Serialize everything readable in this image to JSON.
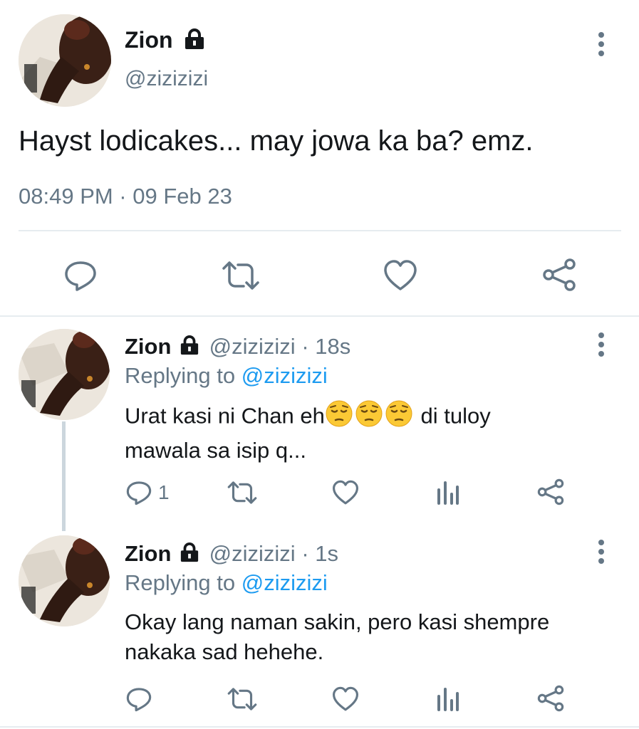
{
  "main_tweet": {
    "name": "Zion",
    "handle": "@zizizizi",
    "text": "Hayst lodicakes... may jowa ka ba? emz.",
    "timestamp": "08:49 PM · 09 Feb 23"
  },
  "replies": [
    {
      "name": "Zion",
      "handle": "@zizizizi",
      "time": "· 18s",
      "replying_prefix": "Replying to ",
      "replying_to": "@zizizizi",
      "text_before_emoji": "Urat kasi ni Chan eh",
      "emojis": [
        "pensive-face",
        "pensive-face",
        "pensive-face"
      ],
      "text_after_emoji": " di tuloy",
      "text_line2": "mawala sa isip q...",
      "reply_count": "1"
    },
    {
      "name": "Zion",
      "handle": "@zizizizi",
      "time": "· 1s",
      "replying_prefix": "Replying to ",
      "replying_to": "@zizizizi",
      "text_line1": "Okay lang naman sakin, pero kasi shempre",
      "text_line2": "nakaka sad hehehe.",
      "reply_count": ""
    }
  ],
  "colors": {
    "text": "#14171a",
    "secondary": "#657786",
    "link": "#1d9bf0",
    "divider": "#e6ecf0"
  }
}
